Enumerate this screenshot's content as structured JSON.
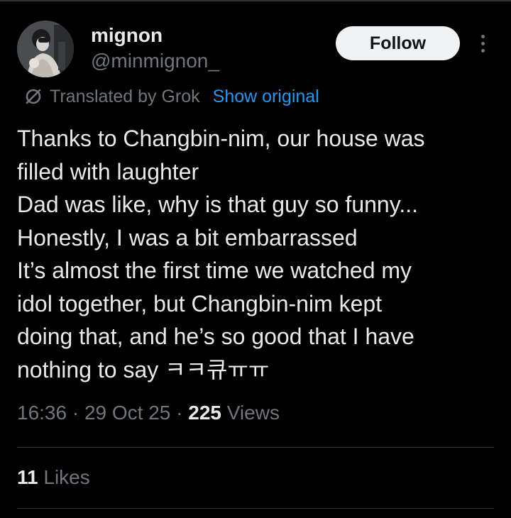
{
  "author": {
    "display_name": "mignon",
    "handle": "@minmignon_",
    "avatar_icon": "user-avatar-photo"
  },
  "actions": {
    "follow_label": "Follow",
    "more_icon": "more-vertical-icon"
  },
  "translation": {
    "icon": "translate-slash-icon",
    "label": "Translated by Grok",
    "show_original_label": "Show original"
  },
  "tweet": {
    "lines": [
      "Thanks to Changbin-nim, our house was",
      "filled with laughter",
      "Dad was like, why is that guy so funny...",
      "Honestly, I was a bit embarrassed",
      "It’s almost the first time we watched my",
      "idol together, but Changbin-nim kept",
      "doing that, and he’s so good that I have",
      "nothing to say ㅋㅋ큐ㅠㅠ"
    ]
  },
  "meta": {
    "time": "16:36",
    "sep1": " · ",
    "date": "29 Oct 25",
    "sep2": " · ",
    "views_count": "225",
    "views_label": " Views"
  },
  "engagement": {
    "likes_count": "11",
    "likes_label": " Likes"
  },
  "colors": {
    "background": "#000000",
    "text": "#e7e9ea",
    "muted": "#71767b",
    "link": "#1d9bf0",
    "button_bg": "#eff3f4",
    "divider": "#2f3336"
  }
}
